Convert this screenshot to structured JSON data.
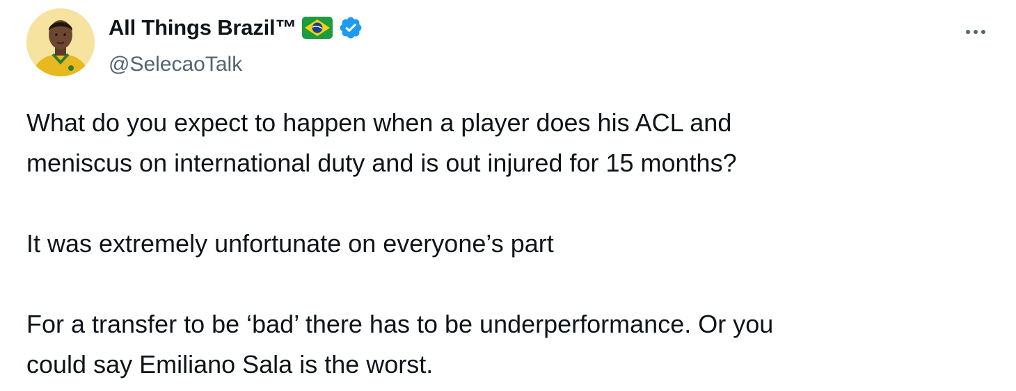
{
  "tweet": {
    "author": {
      "display_name": "All Things Brazil™",
      "handle": "@SelecaoTalk",
      "avatar_icon": "avatar-illustration-icon",
      "flag_icon": "brazil-flag-icon",
      "verified_icon": "verified-badge-icon",
      "verified_color": "#1d9bf0"
    },
    "more_icon": "more-options-icon",
    "paragraphs": [
      "What do you expect to happen when a player does his ACL and\nmeniscus on international duty and is out injured for 15 months?",
      "It was extremely unfortunate on everyone’s part",
      "For a transfer to be ‘bad’ there has to be underperformance. Or you\ncould say Emiliano Sala is the worst."
    ]
  }
}
